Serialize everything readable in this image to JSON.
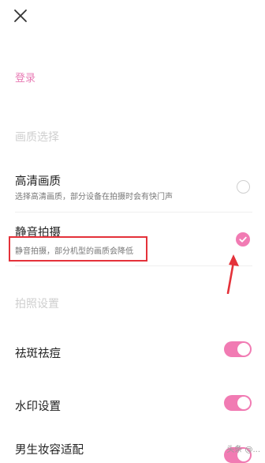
{
  "header": {
    "close_icon": "close-icon"
  },
  "account": {
    "login_label": "登录"
  },
  "quality_section": {
    "title": "画质选择",
    "items": [
      {
        "title": "高清画质",
        "desc": "选择高清画质，部分设备在拍摄时会有快门声",
        "selected": false
      },
      {
        "title": "静音拍摄",
        "desc": "静音拍摄，部分机型的画质会降低",
        "selected": true
      }
    ]
  },
  "photo_section": {
    "title": "拍照设置",
    "items": [
      {
        "title": "祛斑祛痘",
        "enabled": true
      },
      {
        "title": "水印设置",
        "enabled": true
      },
      {
        "title": "男生妆容适配",
        "enabled": true
      }
    ]
  },
  "colors": {
    "accent": "#f17bb3",
    "annotation_red": "#e4323a"
  },
  "watermark": "头条 @..."
}
